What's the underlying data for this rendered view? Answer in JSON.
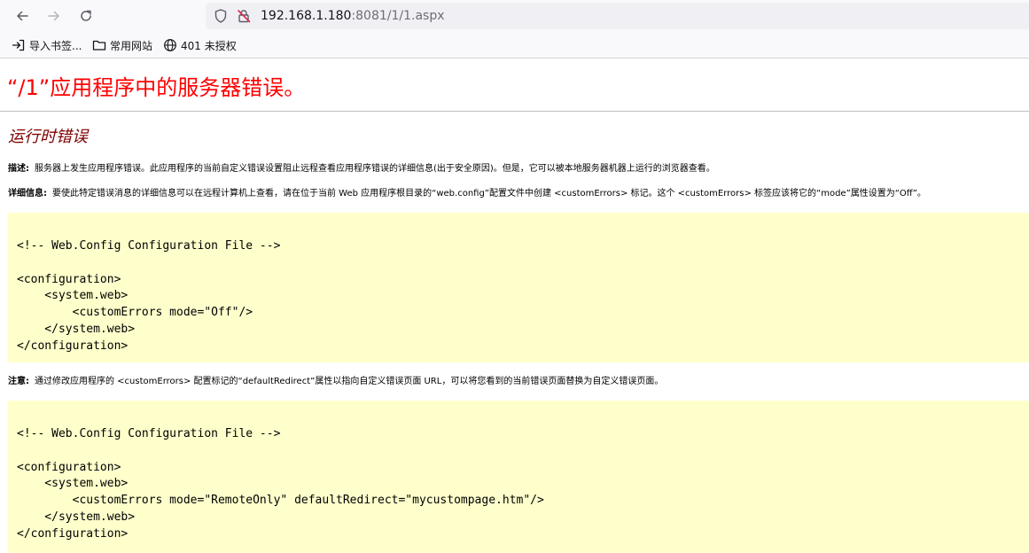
{
  "browser": {
    "url_host": "192.168.1.180",
    "url_rest": ":8081/1/1.aspx",
    "bookmarks": [
      {
        "label": "导入书签..."
      },
      {
        "label": "常用网站"
      },
      {
        "label": "401 未授权"
      }
    ]
  },
  "page": {
    "title": "“/1”应用程序中的服务器错误。",
    "section_title": "运行时错误",
    "description": {
      "label": "描述:",
      "text": "服务器上发生应用程序错误。此应用程序的当前自定义错误设置阻止远程查看应用程序错误的详细信息(出于安全原因)。但是，它可以被本地服务器机器上运行的浏览器查看。"
    },
    "details": {
      "label": "详细信息:",
      "text": "要使此特定错误消息的详细信息可以在远程计算机上查看，请在位于当前 Web 应用程序根目录的“web.config”配置文件中创建 <customErrors> 标记。这个 <customErrors> 标签应该将它的“mode”属性设置为“Off”。"
    },
    "code1": "<!-- Web.Config Configuration File -->\n\n<configuration>\n    <system.web>\n        <customErrors mode=\"Off\"/>\n    </system.web>\n</configuration>",
    "note": {
      "label": "注意:",
      "text": "通过修改应用程序的 <customErrors> 配置标记的“defaultRedirect”属性以指向自定义错误页面 URL，可以将您看到的当前错误页面替换为自定义错误页面。"
    },
    "code2": "<!-- Web.Config Configuration File -->\n\n<configuration>\n    <system.web>\n        <customErrors mode=\"RemoteOnly\" defaultRedirect=\"mycustompage.htm\"/>\n    </system.web>\n</configuration>"
  },
  "colors": {
    "title": "#ff0000",
    "section_title": "#800000",
    "code_background": "#ffffcc"
  },
  "icons": {
    "back": "arrow-left-icon",
    "forward": "arrow-right-icon",
    "reload": "reload-icon",
    "tracking": "shield-icon",
    "insecure": "insecure-lock-icon",
    "import": "import-icon",
    "folder": "folder-icon",
    "site": "globe-icon"
  }
}
